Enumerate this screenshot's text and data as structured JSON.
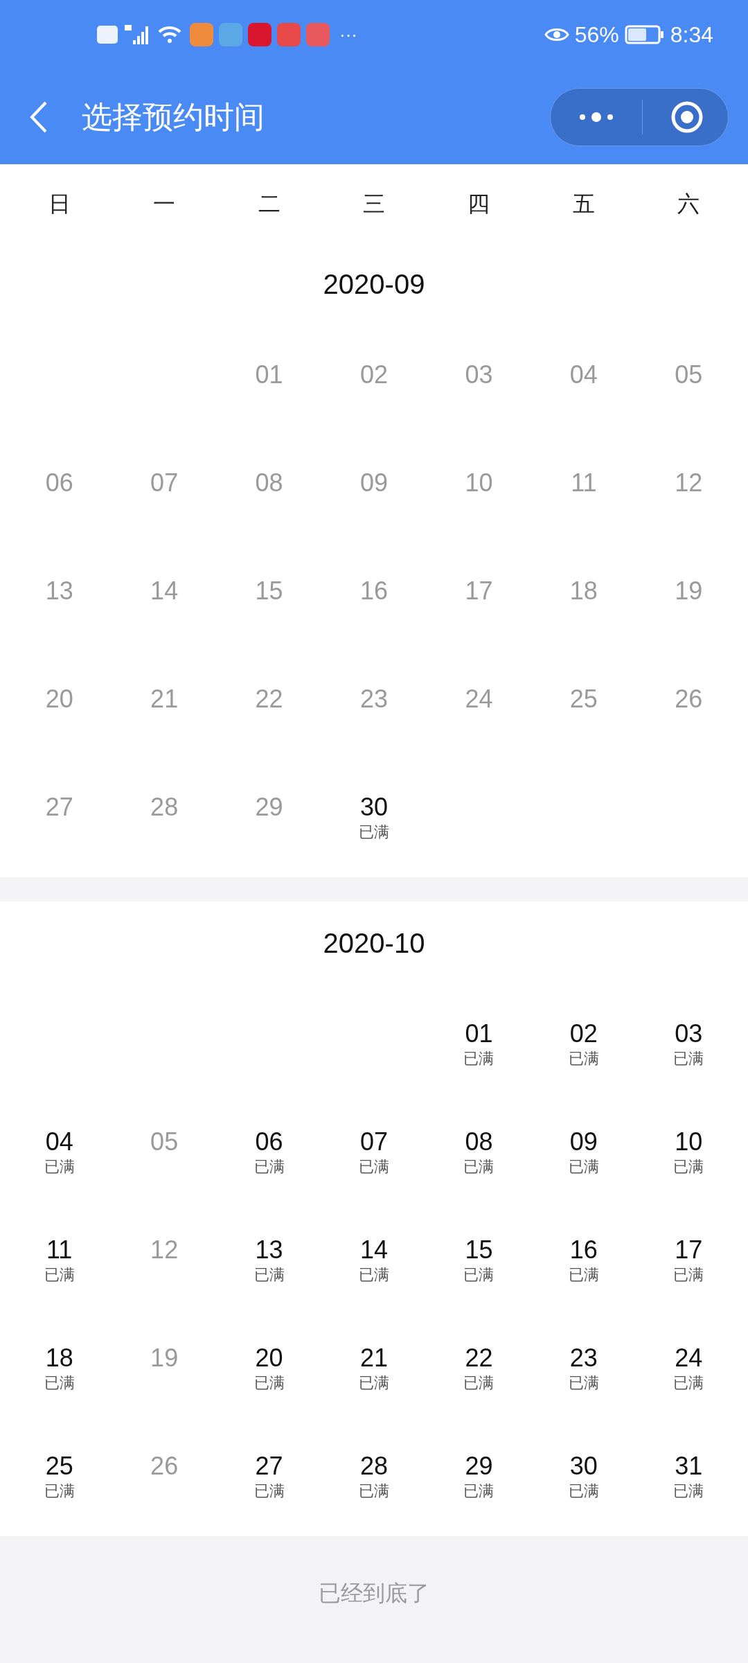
{
  "status_bar": {
    "more": "···",
    "battery": "56%",
    "time": "8:34"
  },
  "header": {
    "title": "选择预约时间"
  },
  "weekdays": [
    "日",
    "一",
    "二",
    "三",
    "四",
    "五",
    "六"
  ],
  "months": [
    {
      "title": "2020-09",
      "weeks": [
        {
          "days": [
            {
              "kind": "blank"
            },
            {
              "kind": "blank"
            },
            {
              "kind": "day",
              "day": "01",
              "enabled": false
            },
            {
              "kind": "day",
              "day": "02",
              "enabled": false
            },
            {
              "kind": "day",
              "day": "03",
              "enabled": false
            },
            {
              "kind": "day",
              "day": "04",
              "enabled": false
            },
            {
              "kind": "day",
              "day": "05",
              "enabled": false
            }
          ]
        },
        {
          "days": [
            {
              "kind": "day",
              "day": "06",
              "enabled": false
            },
            {
              "kind": "day",
              "day": "07",
              "enabled": false
            },
            {
              "kind": "day",
              "day": "08",
              "enabled": false
            },
            {
              "kind": "day",
              "day": "09",
              "enabled": false
            },
            {
              "kind": "day",
              "day": "10",
              "enabled": false
            },
            {
              "kind": "day",
              "day": "11",
              "enabled": false
            },
            {
              "kind": "day",
              "day": "12",
              "enabled": false
            }
          ]
        },
        {
          "days": [
            {
              "kind": "day",
              "day": "13",
              "enabled": false
            },
            {
              "kind": "day",
              "day": "14",
              "enabled": false
            },
            {
              "kind": "day",
              "day": "15",
              "enabled": false
            },
            {
              "kind": "day",
              "day": "16",
              "enabled": false
            },
            {
              "kind": "day",
              "day": "17",
              "enabled": false
            },
            {
              "kind": "day",
              "day": "18",
              "enabled": false
            },
            {
              "kind": "day",
              "day": "19",
              "enabled": false
            }
          ]
        },
        {
          "days": [
            {
              "kind": "day",
              "day": "20",
              "enabled": false
            },
            {
              "kind": "day",
              "day": "21",
              "enabled": false
            },
            {
              "kind": "day",
              "day": "22",
              "enabled": false
            },
            {
              "kind": "day",
              "day": "23",
              "enabled": false
            },
            {
              "kind": "day",
              "day": "24",
              "enabled": false
            },
            {
              "kind": "day",
              "day": "25",
              "enabled": false
            },
            {
              "kind": "day",
              "day": "26",
              "enabled": false
            }
          ]
        },
        {
          "days": [
            {
              "kind": "day",
              "day": "27",
              "enabled": false
            },
            {
              "kind": "day",
              "day": "28",
              "enabled": false
            },
            {
              "kind": "day",
              "day": "29",
              "enabled": false
            },
            {
              "kind": "day",
              "day": "30",
              "enabled": true,
              "status": "已满"
            }
          ]
        }
      ]
    },
    {
      "title": "2020-10",
      "weeks": [
        {
          "days": [
            {
              "kind": "blank"
            },
            {
              "kind": "blank"
            },
            {
              "kind": "blank"
            },
            {
              "kind": "blank"
            },
            {
              "kind": "day",
              "day": "01",
              "enabled": true,
              "status": "已满"
            },
            {
              "kind": "day",
              "day": "02",
              "enabled": true,
              "status": "已满"
            },
            {
              "kind": "day",
              "day": "03",
              "enabled": true,
              "status": "已满"
            }
          ]
        },
        {
          "days": [
            {
              "kind": "day",
              "day": "04",
              "enabled": true,
              "status": "已满"
            },
            {
              "kind": "day",
              "day": "05",
              "enabled": false
            },
            {
              "kind": "day",
              "day": "06",
              "enabled": true,
              "status": "已满"
            },
            {
              "kind": "day",
              "day": "07",
              "enabled": true,
              "status": "已满"
            },
            {
              "kind": "day",
              "day": "08",
              "enabled": true,
              "status": "已满"
            },
            {
              "kind": "day",
              "day": "09",
              "enabled": true,
              "status": "已满"
            },
            {
              "kind": "day",
              "day": "10",
              "enabled": true,
              "status": "已满"
            }
          ]
        },
        {
          "days": [
            {
              "kind": "day",
              "day": "11",
              "enabled": true,
              "status": "已满"
            },
            {
              "kind": "day",
              "day": "12",
              "enabled": false
            },
            {
              "kind": "day",
              "day": "13",
              "enabled": true,
              "status": "已满"
            },
            {
              "kind": "day",
              "day": "14",
              "enabled": true,
              "status": "已满"
            },
            {
              "kind": "day",
              "day": "15",
              "enabled": true,
              "status": "已满"
            },
            {
              "kind": "day",
              "day": "16",
              "enabled": true,
              "status": "已满"
            },
            {
              "kind": "day",
              "day": "17",
              "enabled": true,
              "status": "已满"
            }
          ]
        },
        {
          "days": [
            {
              "kind": "day",
              "day": "18",
              "enabled": true,
              "status": "已满"
            },
            {
              "kind": "day",
              "day": "19",
              "enabled": false
            },
            {
              "kind": "day",
              "day": "20",
              "enabled": true,
              "status": "已满"
            },
            {
              "kind": "day",
              "day": "21",
              "enabled": true,
              "status": "已满"
            },
            {
              "kind": "day",
              "day": "22",
              "enabled": true,
              "status": "已满"
            },
            {
              "kind": "day",
              "day": "23",
              "enabled": true,
              "status": "已满"
            },
            {
              "kind": "day",
              "day": "24",
              "enabled": true,
              "status": "已满"
            }
          ]
        },
        {
          "days": [
            {
              "kind": "day",
              "day": "25",
              "enabled": true,
              "status": "已满"
            },
            {
              "kind": "day",
              "day": "26",
              "enabled": false
            },
            {
              "kind": "day",
              "day": "27",
              "enabled": true,
              "status": "已满"
            },
            {
              "kind": "day",
              "day": "28",
              "enabled": true,
              "status": "已满"
            },
            {
              "kind": "day",
              "day": "29",
              "enabled": true,
              "status": "已满"
            },
            {
              "kind": "day",
              "day": "30",
              "enabled": true,
              "status": "已满"
            },
            {
              "kind": "day",
              "day": "31",
              "enabled": true,
              "status": "已满"
            }
          ]
        }
      ]
    }
  ],
  "footer": {
    "text": "已经到底了"
  }
}
